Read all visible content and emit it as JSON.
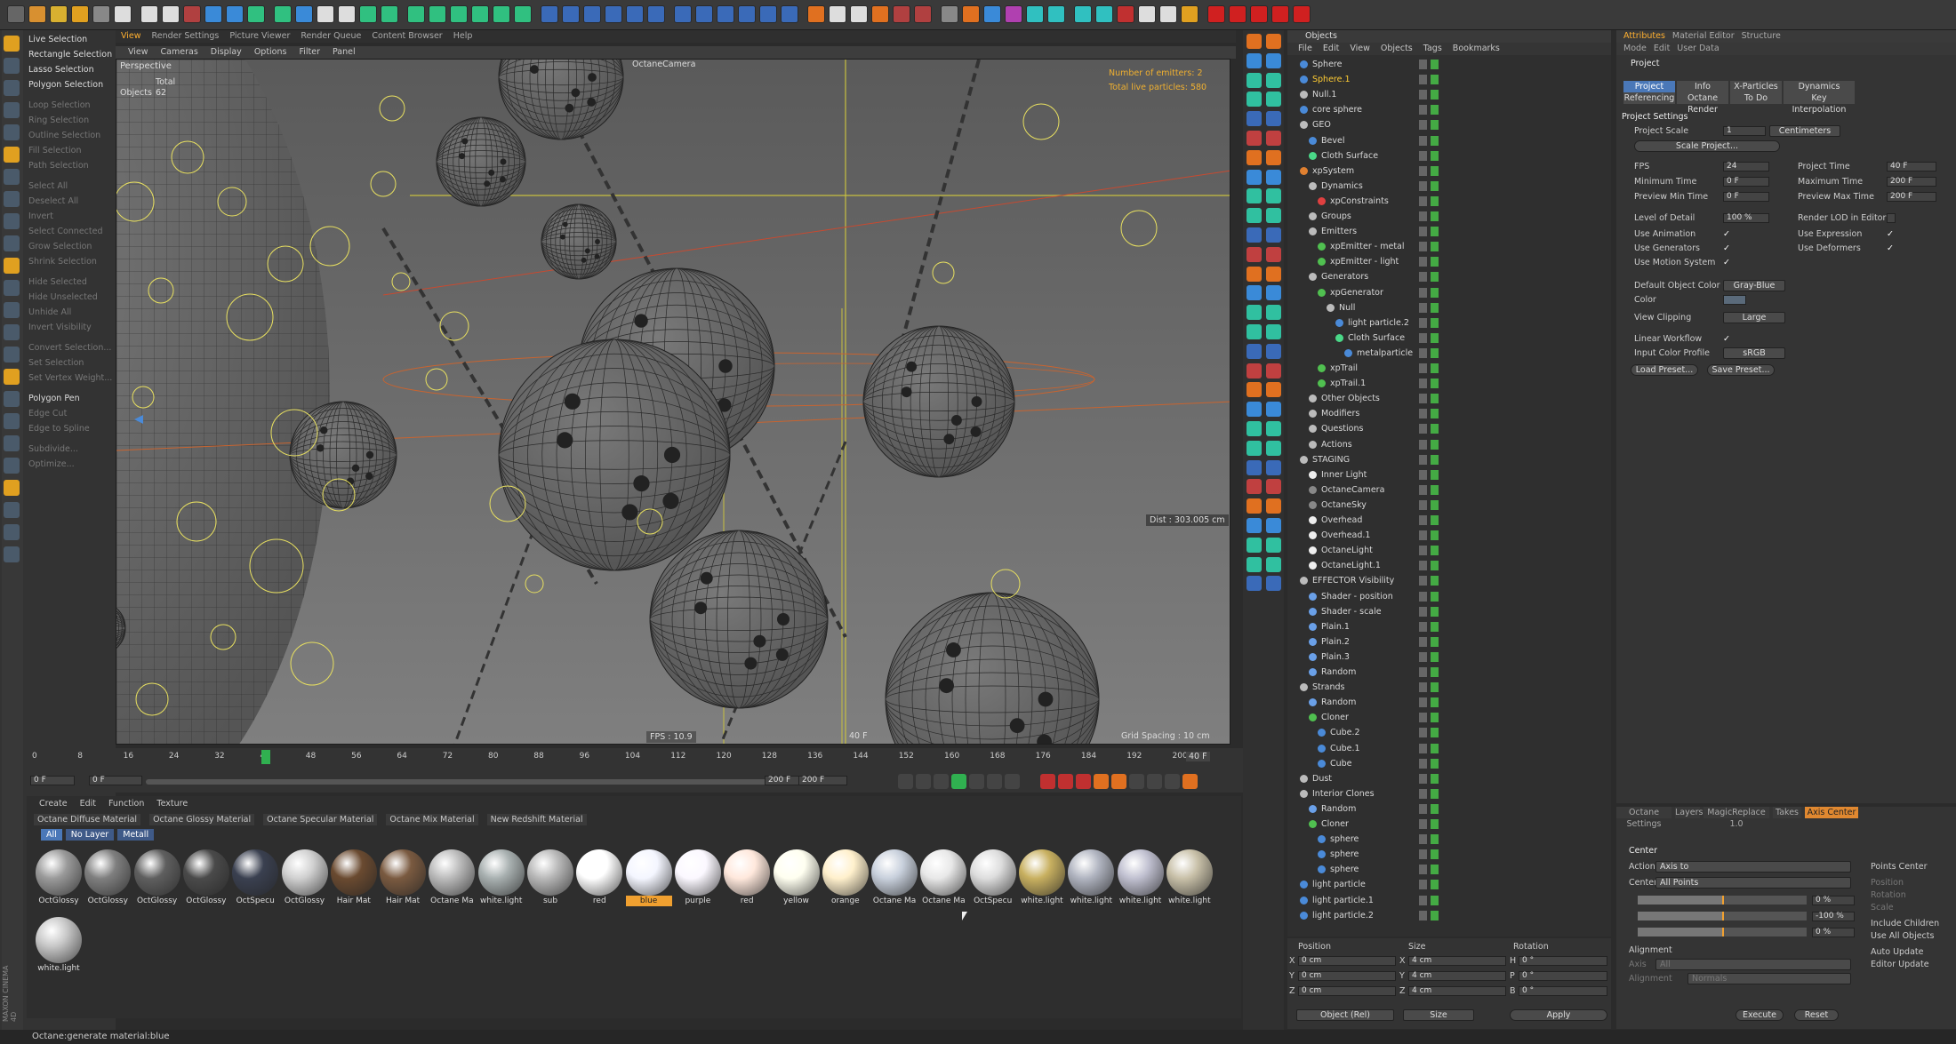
{
  "colors": {
    "accent": "#f0a030",
    "selection": "#4a78b8",
    "selected_item": "#ffcc33",
    "wire": "#e8e060"
  },
  "toolbar": {
    "sep": ""
  },
  "left_menu": [
    {
      "label": "Live Selection",
      "dim": false
    },
    {
      "label": "Rectangle Selection",
      "dim": false
    },
    {
      "label": "Lasso Selection",
      "dim": false
    },
    {
      "label": "Polygon Selection",
      "dim": false
    },
    {
      "label": "Loop Selection",
      "dim": true
    },
    {
      "label": "Ring Selection",
      "dim": true
    },
    {
      "label": "Outline Selection",
      "dim": true
    },
    {
      "label": "Fill Selection",
      "dim": true
    },
    {
      "label": "Path Selection",
      "dim": true
    },
    {
      "label": "Select All",
      "dim": true
    },
    {
      "label": "Deselect All",
      "dim": true
    },
    {
      "label": "Invert",
      "dim": true
    },
    {
      "label": "Select Connected",
      "dim": true
    },
    {
      "label": "Grow Selection",
      "dim": true
    },
    {
      "label": "Shrink Selection",
      "dim": true
    },
    {
      "label": "Hide Selected",
      "dim": true
    },
    {
      "label": "Hide Unselected",
      "dim": true
    },
    {
      "label": "Unhide All",
      "dim": true
    },
    {
      "label": "Invert Visibility",
      "dim": true
    },
    {
      "label": "Convert Selection...",
      "dim": true
    },
    {
      "label": "Set Selection",
      "dim": true
    },
    {
      "label": "Set Vertex Weight...",
      "dim": true
    },
    {
      "label": "Polygon Pen",
      "dim": false
    },
    {
      "label": "Edge Cut",
      "dim": true
    },
    {
      "label": "Edge to Spline",
      "dim": true
    },
    {
      "label": "Subdivide...",
      "dim": true
    },
    {
      "label": "Optimize...",
      "dim": true
    }
  ],
  "viewport_tabs": [
    "View",
    "Render Settings",
    "Picture Viewer",
    "Render Queue",
    "Content Browser",
    "Help"
  ],
  "viewport_menu": [
    "View",
    "Cameras",
    "Display",
    "Options",
    "Filter",
    "Panel"
  ],
  "viewport": {
    "mode": "Perspective",
    "camera": "OctaneCamera",
    "stats_label": "Total",
    "objects_label": "Objects",
    "objects_count": "62",
    "emitters": "Number of emitters: 2",
    "particles": "Total live particles: 580",
    "dist": "Dist : 303.005 cm",
    "fps": "FPS : 10.9",
    "frame": "40 F",
    "grid": "Grid Spacing : 10 cm"
  },
  "timeline": {
    "ticks": [
      "0",
      "8",
      "16",
      "24",
      "32",
      "40",
      "48",
      "56",
      "64",
      "72",
      "80",
      "88",
      "96",
      "104",
      "112",
      "120",
      "128",
      "136",
      "144",
      "152",
      "160",
      "168",
      "176",
      "184",
      "192",
      "200"
    ],
    "current": "40",
    "end": "40 F",
    "start_field": "0 F",
    "min_field": "0 F",
    "max_field": "200 F",
    "range_end": "200 F"
  },
  "material_menu": [
    "Create",
    "Edit",
    "Function",
    "Texture"
  ],
  "material_tabs": [
    "Octane Diffuse Material",
    "Octane Glossy Material",
    "Octane Specular Material",
    "Octane Mix Material",
    "New Redshift Material"
  ],
  "layer_tabs": [
    "All",
    "No Layer",
    "Metall"
  ],
  "materials": [
    {
      "label": "OctGlossy",
      "color": "#9a9a9a",
      "sel": false
    },
    {
      "label": "OctGlossy",
      "color": "#7f7f7f",
      "sel": false
    },
    {
      "label": "OctGlossy",
      "color": "#5f5f5f",
      "sel": false
    },
    {
      "label": "OctGlossy",
      "color": "#4a4a4a",
      "sel": false
    },
    {
      "label": "OctSpecu",
      "color": "#3a4050",
      "sel": false
    },
    {
      "label": "OctGlossy",
      "color": "#d0d0d0",
      "sel": false
    },
    {
      "label": "Hair Mat",
      "color": "#6a4a30",
      "sel": false
    },
    {
      "label": "Hair Mat",
      "color": "#7a5a40",
      "sel": false
    },
    {
      "label": "Octane Ma",
      "color": "#bbbbbb",
      "sel": false
    },
    {
      "label": "white.light",
      "color": "#a8b0b0",
      "sel": false
    },
    {
      "label": "sub",
      "color": "#b8b8b8",
      "sel": false
    },
    {
      "label": "red",
      "color": "#ffffff",
      "sel": false
    },
    {
      "label": "blue",
      "color": "#f4f6ff",
      "sel": true
    },
    {
      "label": "purple",
      "color": "#fbf8ff",
      "sel": false
    },
    {
      "label": "red",
      "color": "#ffe8dc",
      "sel": false
    },
    {
      "label": "yellow",
      "color": "#fffff0",
      "sel": false
    },
    {
      "label": "orange",
      "color": "#fff0cc",
      "sel": false
    },
    {
      "label": "Octane Ma",
      "color": "#c8d0dc",
      "sel": false
    },
    {
      "label": "Octane Ma",
      "color": "#e8e8e8",
      "sel": false
    },
    {
      "label": "OctSpecu",
      "color": "#dddddd",
      "sel": false
    },
    {
      "label": "white.light",
      "color": "#c8b060",
      "sel": false
    },
    {
      "label": "white.light",
      "color": "#b0b4c0",
      "sel": false
    },
    {
      "label": "white.light",
      "color": "#c0c0d0",
      "sel": false
    },
    {
      "label": "white.light",
      "color": "#c8c0a8",
      "sel": false
    },
    {
      "label": "white.light",
      "color": "#c8c8c8",
      "sel": false
    }
  ],
  "objects_panel": {
    "title": "Objects",
    "menu": [
      "File",
      "Edit",
      "View",
      "Objects",
      "Tags",
      "Bookmarks"
    ],
    "rows": [
      {
        "name": "Sphere",
        "indent": 0,
        "color": "#4a8ad8",
        "hi": false
      },
      {
        "name": "Sphere.1",
        "indent": 0,
        "color": "#4a8ad8",
        "hi": true
      },
      {
        "name": "Null.1",
        "indent": 0,
        "color": "#bbbbbb",
        "hi": false
      },
      {
        "name": "core sphere",
        "indent": 0,
        "color": "#4a8ad8",
        "hi": false
      },
      {
        "name": "GEO",
        "indent": 0,
        "color": "#bbbbbb",
        "hi": false
      },
      {
        "name": "Bevel",
        "indent": 1,
        "color": "#4a8ad8",
        "hi": false
      },
      {
        "name": "Cloth Surface",
        "indent": 1,
        "color": "#4ad888",
        "hi": false
      },
      {
        "name": "xpSystem",
        "indent": 0,
        "color": "#e08030",
        "hi": false
      },
      {
        "name": "Dynamics",
        "indent": 1,
        "color": "#bbbbbb",
        "hi": false
      },
      {
        "name": "xpConstraints",
        "indent": 2,
        "color": "#e04040",
        "hi": false
      },
      {
        "name": "Groups",
        "indent": 1,
        "color": "#bbbbbb",
        "hi": false
      },
      {
        "name": "Emitters",
        "indent": 1,
        "color": "#bbbbbb",
        "hi": false
      },
      {
        "name": "xpEmitter - metal",
        "indent": 2,
        "color": "#50c050",
        "hi": false
      },
      {
        "name": "xpEmitter - light",
        "indent": 2,
        "color": "#50c050",
        "hi": false
      },
      {
        "name": "Generators",
        "indent": 1,
        "color": "#bbbbbb",
        "hi": false
      },
      {
        "name": "xpGenerator",
        "indent": 2,
        "color": "#50c050",
        "hi": false
      },
      {
        "name": "Null",
        "indent": 3,
        "color": "#bbbbbb",
        "hi": false
      },
      {
        "name": "light particle.2",
        "indent": 4,
        "color": "#4a8ad8",
        "hi": false
      },
      {
        "name": "Cloth Surface",
        "indent": 4,
        "color": "#4ad888",
        "hi": false
      },
      {
        "name": "metalparticle",
        "indent": 5,
        "color": "#4a8ad8",
        "hi": false
      },
      {
        "name": "xpTrail",
        "indent": 2,
        "color": "#50c050",
        "hi": false
      },
      {
        "name": "xpTrail.1",
        "indent": 2,
        "color": "#50c050",
        "hi": false
      },
      {
        "name": "Other Objects",
        "indent": 1,
        "color": "#bbbbbb",
        "hi": false
      },
      {
        "name": "Modifiers",
        "indent": 1,
        "color": "#bbbbbb",
        "hi": false
      },
      {
        "name": "Questions",
        "indent": 1,
        "color": "#bbbbbb",
        "hi": false
      },
      {
        "name": "Actions",
        "indent": 1,
        "color": "#bbbbbb",
        "hi": false
      },
      {
        "name": "STAGING",
        "indent": 0,
        "color": "#bbbbbb",
        "hi": false
      },
      {
        "name": "Inner Light",
        "indent": 1,
        "color": "#eeeeee",
        "hi": false
      },
      {
        "name": "OctaneCamera",
        "indent": 1,
        "color": "#888888",
        "hi": false
      },
      {
        "name": "OctaneSky",
        "indent": 1,
        "color": "#888888",
        "hi": false
      },
      {
        "name": "Overhead",
        "indent": 1,
        "color": "#eeeeee",
        "hi": false
      },
      {
        "name": "Overhead.1",
        "indent": 1,
        "color": "#eeeeee",
        "hi": false
      },
      {
        "name": "OctaneLight",
        "indent": 1,
        "color": "#eeeeee",
        "hi": false
      },
      {
        "name": "OctaneLight.1",
        "indent": 1,
        "color": "#eeeeee",
        "hi": false
      },
      {
        "name": "EFFECTOR Visibility",
        "indent": 0,
        "color": "#bbbbbb",
        "hi": false
      },
      {
        "name": "Shader - position",
        "indent": 1,
        "color": "#6aa0e8",
        "hi": false
      },
      {
        "name": "Shader - scale",
        "indent": 1,
        "color": "#6aa0e8",
        "hi": false
      },
      {
        "name": "Plain.1",
        "indent": 1,
        "color": "#6aa0e8",
        "hi": false
      },
      {
        "name": "Plain.2",
        "indent": 1,
        "color": "#6aa0e8",
        "hi": false
      },
      {
        "name": "Plain.3",
        "indent": 1,
        "color": "#6aa0e8",
        "hi": false
      },
      {
        "name": "Random",
        "indent": 1,
        "color": "#6aa0e8",
        "hi": false
      },
      {
        "name": "Strands",
        "indent": 0,
        "color": "#bbbbbb",
        "hi": false
      },
      {
        "name": "Random",
        "indent": 1,
        "color": "#6aa0e8",
        "hi": false
      },
      {
        "name": "Cloner",
        "indent": 1,
        "color": "#50c050",
        "hi": false
      },
      {
        "name": "Cube.2",
        "indent": 2,
        "color": "#4a8ad8",
        "hi": false
      },
      {
        "name": "Cube.1",
        "indent": 2,
        "color": "#4a8ad8",
        "hi": false
      },
      {
        "name": "Cube",
        "indent": 2,
        "color": "#4a8ad8",
        "hi": false
      },
      {
        "name": "Dust",
        "indent": 0,
        "color": "#bbbbbb",
        "hi": false
      },
      {
        "name": "Interior Clones",
        "indent": 0,
        "color": "#bbbbbb",
        "hi": false
      },
      {
        "name": "Random",
        "indent": 1,
        "color": "#6aa0e8",
        "hi": false
      },
      {
        "name": "Cloner",
        "indent": 1,
        "color": "#50c050",
        "hi": false
      },
      {
        "name": "sphere",
        "indent": 2,
        "color": "#4a8ad8",
        "hi": false
      },
      {
        "name": "sphere",
        "indent": 2,
        "color": "#4a8ad8",
        "hi": false
      },
      {
        "name": "sphere",
        "indent": 2,
        "color": "#4a8ad8",
        "hi": false
      },
      {
        "name": "light particle",
        "indent": 0,
        "color": "#4a8ad8",
        "hi": false
      },
      {
        "name": "light particle.1",
        "indent": 0,
        "color": "#4a8ad8",
        "hi": false
      },
      {
        "name": "light particle.2",
        "indent": 0,
        "color": "#4a8ad8",
        "hi": false
      }
    ]
  },
  "coords": {
    "headers": [
      "Position",
      "Size",
      "Rotation"
    ],
    "rows": [
      {
        "a": "X",
        "p": "0 cm",
        "s": "4 cm",
        "r": "H",
        "rv": "0 °"
      },
      {
        "a": "Y",
        "p": "0 cm",
        "s": "4 cm",
        "r": "P",
        "rv": "0 °"
      },
      {
        "a": "Z",
        "p": "0 cm",
        "s": "4 cm",
        "r": "B",
        "rv": "0 °"
      }
    ],
    "mode": "Object (Rel)",
    "size_mode": "Size",
    "apply": "Apply"
  },
  "attributes": {
    "tabs": [
      "Attributes",
      "Material Editor",
      "Structure"
    ],
    "menu": [
      "Mode",
      "Edit",
      "User Data"
    ],
    "title": "Project",
    "subtabs": [
      "Project Settings",
      "Info",
      "X-Particles",
      "Dynamics",
      "Referencing",
      "Octane Render",
      "To Do",
      "Key Interpolation"
    ],
    "section": "Project Settings",
    "scale_label": "Project Scale",
    "scale_value": "1",
    "scale_unit": "Centimeters",
    "scale_btn": "Scale Project...",
    "left_fields": [
      {
        "l": "FPS",
        "v": "24"
      },
      {
        "l": "Minimum Time",
        "v": "0 F"
      },
      {
        "l": "Preview Min Time",
        "v": "0 F"
      },
      {
        "l": "Level of Detail",
        "v": "100 %"
      }
    ],
    "right_fields": [
      {
        "l": "Project Time",
        "v": "40 F"
      },
      {
        "l": "Maximum Time",
        "v": "200 F"
      },
      {
        "l": "Preview Max Time",
        "v": "200 F"
      },
      {
        "l": "Render LOD in Editor",
        "v": ""
      }
    ],
    "checks_left": [
      "Use Animation",
      "Use Generators",
      "Use Motion System"
    ],
    "checks_right": [
      "Use Expression",
      "Use Deformers"
    ],
    "color_label": "Default Object Color",
    "color_value": "Gray-Blue",
    "color2_label": "Color",
    "clip_label": "View Clipping",
    "clip_value": "Large",
    "linear_label": "Linear Workflow",
    "profile_label": "Input Color Profile",
    "profile_value": "sRGB",
    "load": "Load Preset...",
    "save": "Save Preset..."
  },
  "axis_panel": {
    "tabs": [
      "Octane Settings",
      "Layers",
      "MagicReplace 1.0",
      "Takes",
      "Axis Center"
    ],
    "center": "Center",
    "action_label": "Action",
    "action_value": "Axis to",
    "center_label": "Center",
    "center_value": "All Points",
    "x_val": "0 %",
    "y_val": "-100 %",
    "z_val": "0 %",
    "alignment": "Alignment",
    "axis_label": "Axis",
    "axis_value": "All",
    "align_label": "Alignment",
    "align_value": "Normals",
    "right_opts": [
      "Points Center",
      "Position",
      "Rotation",
      "Scale",
      "Include Children",
      "Use All Objects",
      "Auto Update",
      "Editor Update"
    ],
    "execute": "Execute",
    "reset": "Reset"
  },
  "status": "Octane:generate material:blue",
  "brand": "MAXON CINEMA 4D"
}
